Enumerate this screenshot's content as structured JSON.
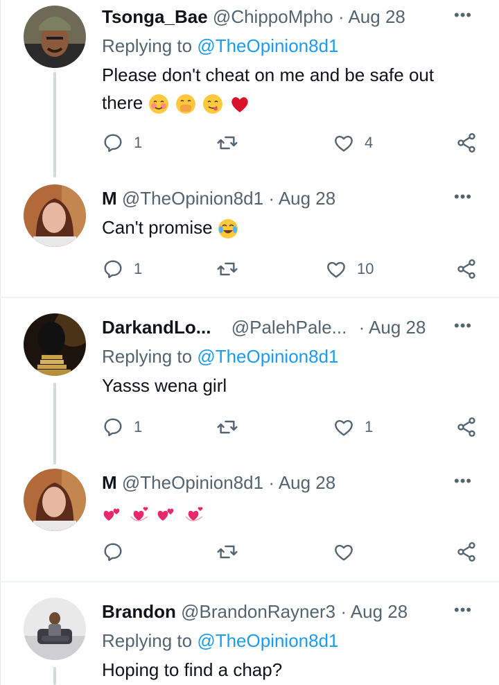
{
  "tweets": [
    {
      "name": "Tsonga_Bae",
      "handle": "@ChippoMpho",
      "dot": "·",
      "date": "Aug 28",
      "replying_prefix": "Replying to ",
      "replying_to": "@TheOpinion8d1",
      "text_line1": "Please don't cheat on me and be safe out",
      "text_line2": "there",
      "emojis": [
        "smiling-blush-emoji",
        "hand-over-mouth-emoji",
        "yum-emoji",
        "red-heart-emoji"
      ],
      "reply_count": "1",
      "retweet_count": "",
      "like_count": "4"
    },
    {
      "name": "M",
      "handle": "@TheOpinion8d1",
      "dot": "·",
      "date": "Aug 28",
      "text": "Can't promise",
      "emojis": [
        "tears-of-joy-emoji"
      ],
      "reply_count": "1",
      "retweet_count": "",
      "like_count": "10"
    },
    {
      "name": "DarkandLo...",
      "handle": "@PalehPale...",
      "dot": "·",
      "date": "Aug 28",
      "replying_prefix": "Replying to ",
      "replying_to": "@TheOpinion8d1",
      "text": "Yasss wena girl",
      "reply_count": "1",
      "retweet_count": "",
      "like_count": "1"
    },
    {
      "name": "M",
      "handle": "@TheOpinion8d1",
      "dot": "·",
      "date": "Aug 28",
      "emojis": [
        "two-hearts-emoji",
        "revolving-hearts-emoji",
        "two-hearts-emoji",
        "revolving-hearts-emoji"
      ],
      "reply_count": "",
      "retweet_count": "",
      "like_count": ""
    },
    {
      "name": "Brandon",
      "handle": "@BrandonRayner3",
      "dot": "·",
      "date": "Aug 28",
      "replying_prefix": "Replying to ",
      "replying_to": "@TheOpinion8d1",
      "text": "Hoping to find a chap?"
    }
  ],
  "more_label": "•••",
  "colors": {
    "link": "#1d9bf0",
    "muted": "#536471",
    "text": "#0f1419",
    "thread_line": "#cfd9de"
  }
}
